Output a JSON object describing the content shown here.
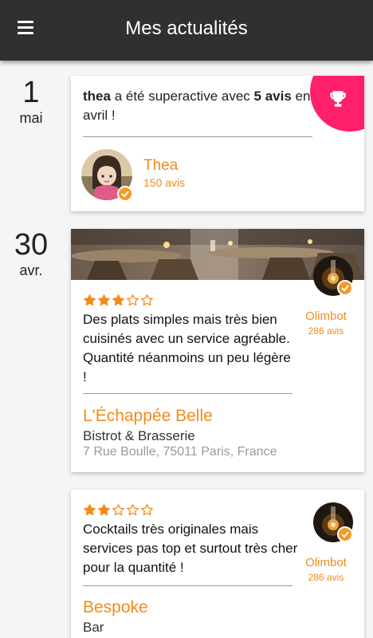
{
  "header": {
    "title": "Mes actualités",
    "menu_icon": "hamburger-menu-icon"
  },
  "colors": {
    "appbar": "#303030",
    "accent": "#f38a1c",
    "trophy_badge": "#ff1f6c",
    "background": "#f5f5f5"
  },
  "feed": [
    {
      "date": {
        "day": "1",
        "month": "mai"
      },
      "activity": {
        "user": "thea",
        "text_middle": " a été superactive avec ",
        "count": "5 avis",
        "text_end": " en avril !",
        "badge_icon": "trophy-icon"
      },
      "user": {
        "name": "Thea",
        "reviews": "150 avis",
        "verified_icon": "check-badge-icon"
      }
    },
    {
      "date": {
        "day": "30",
        "month": "avr."
      },
      "review": {
        "rating": 3,
        "max_rating": 5,
        "text": "Des plats simples mais très bien cuisinés avec un service agréable. Quantité néanmoins un peu légère !",
        "reviewer": {
          "name": "Olimbot",
          "reviews": "286 avis"
        },
        "place": {
          "name": "L'Échappée Belle",
          "type": "Bistrot & Brasserie",
          "address": "7 Rue Boulle, 75011 Paris, France"
        }
      }
    },
    {
      "review": {
        "rating": 2,
        "max_rating": 5,
        "text": "Cocktails très originales mais services pas top et surtout très cher pour la quantité !",
        "reviewer": {
          "name": "Olimbot",
          "reviews": "286 avis"
        },
        "place": {
          "name": "Bespoke",
          "type": "Bar"
        }
      }
    }
  ]
}
